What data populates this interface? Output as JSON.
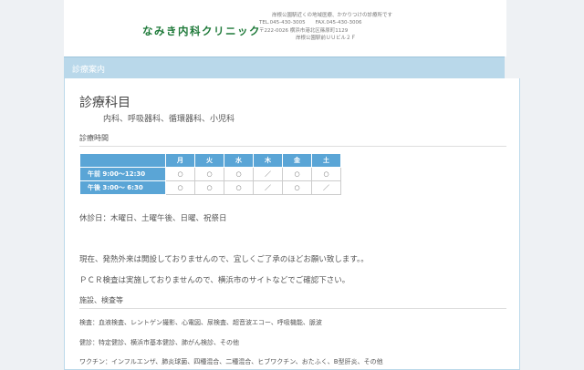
{
  "header": {
    "logo": "なみき内科クリニック",
    "tagline": "岸根公園駅近くの地域医療、かかりつけの診療所です",
    "tel": "TEL.045-430-3005　　FAX.045-430-3006",
    "address": "〒222-0026 横浜市港北区篠原町1129",
    "building": "岸根公園駅前ＵＵビル２Ｆ"
  },
  "band": {
    "title": "診療案内"
  },
  "main": {
    "title": "診療科目",
    "departments": "内科、呼吸器科、循環器科、小児科",
    "hours_heading": "診療時間",
    "days": [
      "月",
      "火",
      "水",
      "木",
      "金",
      "土"
    ],
    "rows": [
      {
        "label": "午前 9:00〜12:30",
        "cells": [
          "○",
          "○",
          "○",
          "／",
          "○",
          "○"
        ]
      },
      {
        "label": "午後 3:00〜 6:30",
        "cells": [
          "○",
          "○",
          "○",
          "／",
          "○",
          "／"
        ]
      }
    ],
    "closed": "休診日：木曜日、土曜午後、日曜、祝祭日",
    "notice1": "現在、発熱外来は開設しておりませんので、宜しくご了承のほどお願い致します。。",
    "notice2": "ＰＣＲ検査は実施しておりませんので、横浜市のサイトなどでご確認下さい。",
    "facilities_heading": "施設、検査等",
    "exams": "検査：血液検査、レントゲン撮影、心電図、尿検査、超音波エコー、呼吸機能、脈波",
    "checkups": "健診：特定健診、横浜市基本健診、肺がん検診、その他",
    "vaccines": "ワクチン：インフルエンザ、肺炎球菌、四種混合、二種混合、ヒブワクチン、おたふく、B型肝炎、その他"
  }
}
